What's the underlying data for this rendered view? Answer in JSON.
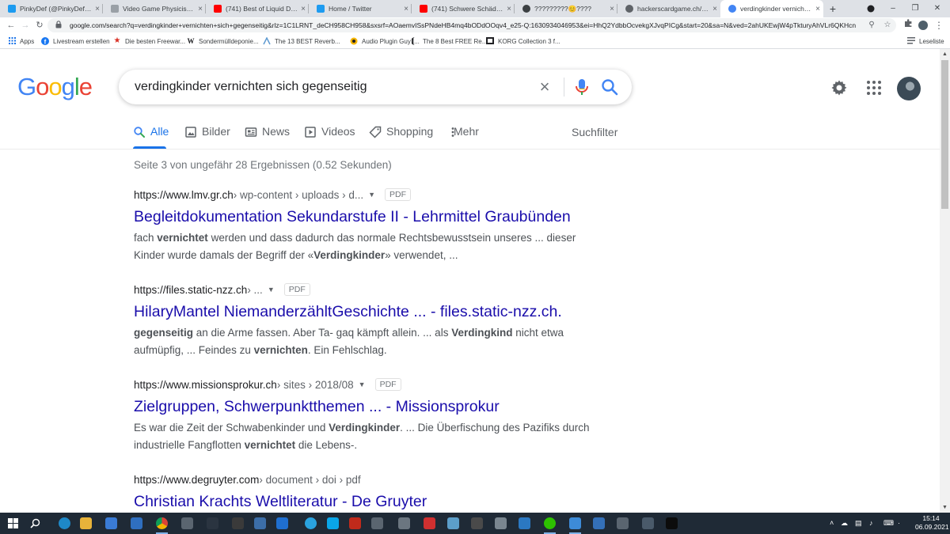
{
  "browser": {
    "tabs": [
      {
        "title": "PinkyDef (@PinkyDef) / Tw",
        "icon": "twitter-icon",
        "color": "#1d9bf0",
        "active": false
      },
      {
        "title": "Video Game Physicists Pro",
        "icon": "page-icon",
        "color": "#9aa0a6",
        "active": false
      },
      {
        "title": "(741) Best of Liquid Drum",
        "icon": "youtube-icon",
        "color": "#ff0000",
        "active": false
      },
      {
        "title": "Home / Twitter",
        "icon": "twitter-icon",
        "color": "#1d9bf0",
        "active": false
      },
      {
        "title": "(741) Schwere Schädigung",
        "icon": "youtube-icon",
        "color": "#ff0000",
        "active": false
      },
      {
        "title": "?????????😊????",
        "icon": "settings-circle-icon",
        "color": "#3c4043",
        "active": false
      },
      {
        "title": "hackerscardgame.ch/jpg/E",
        "icon": "globe-icon",
        "color": "#5f6368",
        "active": false
      },
      {
        "title": "verdingkinder vernichten s",
        "icon": "google-icon",
        "color": "#4285f4",
        "active": true
      }
    ],
    "url": "google.com/search?q=verdingkinder+vernichten+sich+gegenseitig&rlz=1C1LRNT_deCH958CH958&sxsrf=AOaemvISsPNdeHB4mq4bODdOOqv4_e25-Q:1630934046953&ei=HhQ2YdbbOcvekgXJvqPICg&start=20&sa=N&ved=2ahUKEwjW4pTkturyAhVLr6QKHcn",
    "bookmarks": [
      {
        "label": "Apps",
        "icon": "apps-grid-icon",
        "color": "#1a73e8"
      },
      {
        "label": "Livestream erstellen",
        "icon": "facebook-icon",
        "color": "#1877f2"
      },
      {
        "label": "Die besten Freewar...",
        "icon": "star-icon",
        "color": "#d93025"
      },
      {
        "label": "Sondermülldeponie...",
        "icon": "wikipedia-icon",
        "color": "#202124"
      },
      {
        "label": "The 13 BEST Reverb...",
        "icon": "audio-icon",
        "color": "#5f9bd1"
      },
      {
        "label": "Audio Plugin Guy |...",
        "icon": "audio-plugin-icon",
        "color": "#f4b400"
      },
      {
        "label": "The 8 Best FREE Re...",
        "icon": "bookmark-icon",
        "color": "#202124"
      },
      {
        "label": "KORG Collection 3 f...",
        "icon": "korg-icon",
        "color": "#202124"
      }
    ],
    "reading_list": "Leseliste"
  },
  "google": {
    "logo": "Google",
    "query": "verdingkinder vernichten sich gegenseitig",
    "tabs": [
      {
        "label": "Alle",
        "icon": "search-icon",
        "active": true
      },
      {
        "label": "Bilder",
        "icon": "image-icon",
        "active": false
      },
      {
        "label": "News",
        "icon": "news-icon",
        "active": false
      },
      {
        "label": "Videos",
        "icon": "video-icon",
        "active": false
      },
      {
        "label": "Shopping",
        "icon": "tag-icon",
        "active": false
      },
      {
        "label": "Mehr",
        "icon": "more-vert-icon",
        "active": false
      }
    ],
    "filter_label": "Suchfilter",
    "stats": "Seite 3 von ungefähr 28 Ergebnissen (0.52 Sekunden)"
  },
  "results": [
    {
      "domain": "https://www.lmv.gr.ch",
      "path": " › wp-content › uploads › d...",
      "tag": "PDF",
      "title": "Begleitdokumentation Sekundarstufe II - Lehrmittel Graubünden",
      "snippet": [
        [
          {
            "t": "fach ",
            "b": false
          },
          {
            "t": "vernichtet",
            "b": true
          },
          {
            "t": " werden und dass dadurch das normale Rechtsbewusstsein unseres ... dieser",
            "b": false
          }
        ],
        [
          {
            "t": "Kinder wurde damals der Begriff der «",
            "b": false
          },
          {
            "t": "Verdingkinder",
            "b": true
          },
          {
            "t": "» verwendet, ...",
            "b": false
          }
        ]
      ]
    },
    {
      "domain": "https://files.static-nzz.ch",
      "path": " › ...",
      "tag": "PDF",
      "title": "HilaryMantel NiemanderzähltGeschichte ... - files.static-nzz.ch.",
      "snippet": [
        [
          {
            "t": "gegenseitig",
            "b": true
          },
          {
            "t": " an die Arme fassen. Aber Ta- gaq kämpft allein. ... als ",
            "b": false
          },
          {
            "t": "Verdingkind",
            "b": true
          },
          {
            "t": " nicht etwa",
            "b": false
          }
        ],
        [
          {
            "t": "aufmüpfig, ... Feindes zu ",
            "b": false
          },
          {
            "t": "vernichten",
            "b": true
          },
          {
            "t": ". Ein Fehlschlag.",
            "b": false
          }
        ]
      ]
    },
    {
      "domain": "https://www.missionsprokur.ch",
      "path": " › sites › 2018/08",
      "tag": "PDF",
      "title": "Zielgruppen, Schwerpunktthemen ... - Missionsprokur",
      "snippet": [
        [
          {
            "t": "Es war die Zeit der Schwabenkinder und ",
            "b": false
          },
          {
            "t": "Verdingkinder",
            "b": true
          },
          {
            "t": ". ... Die Überfischung des Pazifiks durch",
            "b": false
          }
        ],
        [
          {
            "t": "industrielle Fangflotten ",
            "b": false
          },
          {
            "t": "vernichtet",
            "b": true
          },
          {
            "t": " die Lebens-.",
            "b": false
          }
        ]
      ]
    },
    {
      "domain": "https://www.degruyter.com",
      "path": " › document › doi › pdf",
      "tag": "",
      "title": "Christian Krachts Weltliteratur - De Gruyter",
      "snippet": []
    }
  ],
  "taskbar": {
    "time": "15:14",
    "date": "06.09.2021"
  }
}
